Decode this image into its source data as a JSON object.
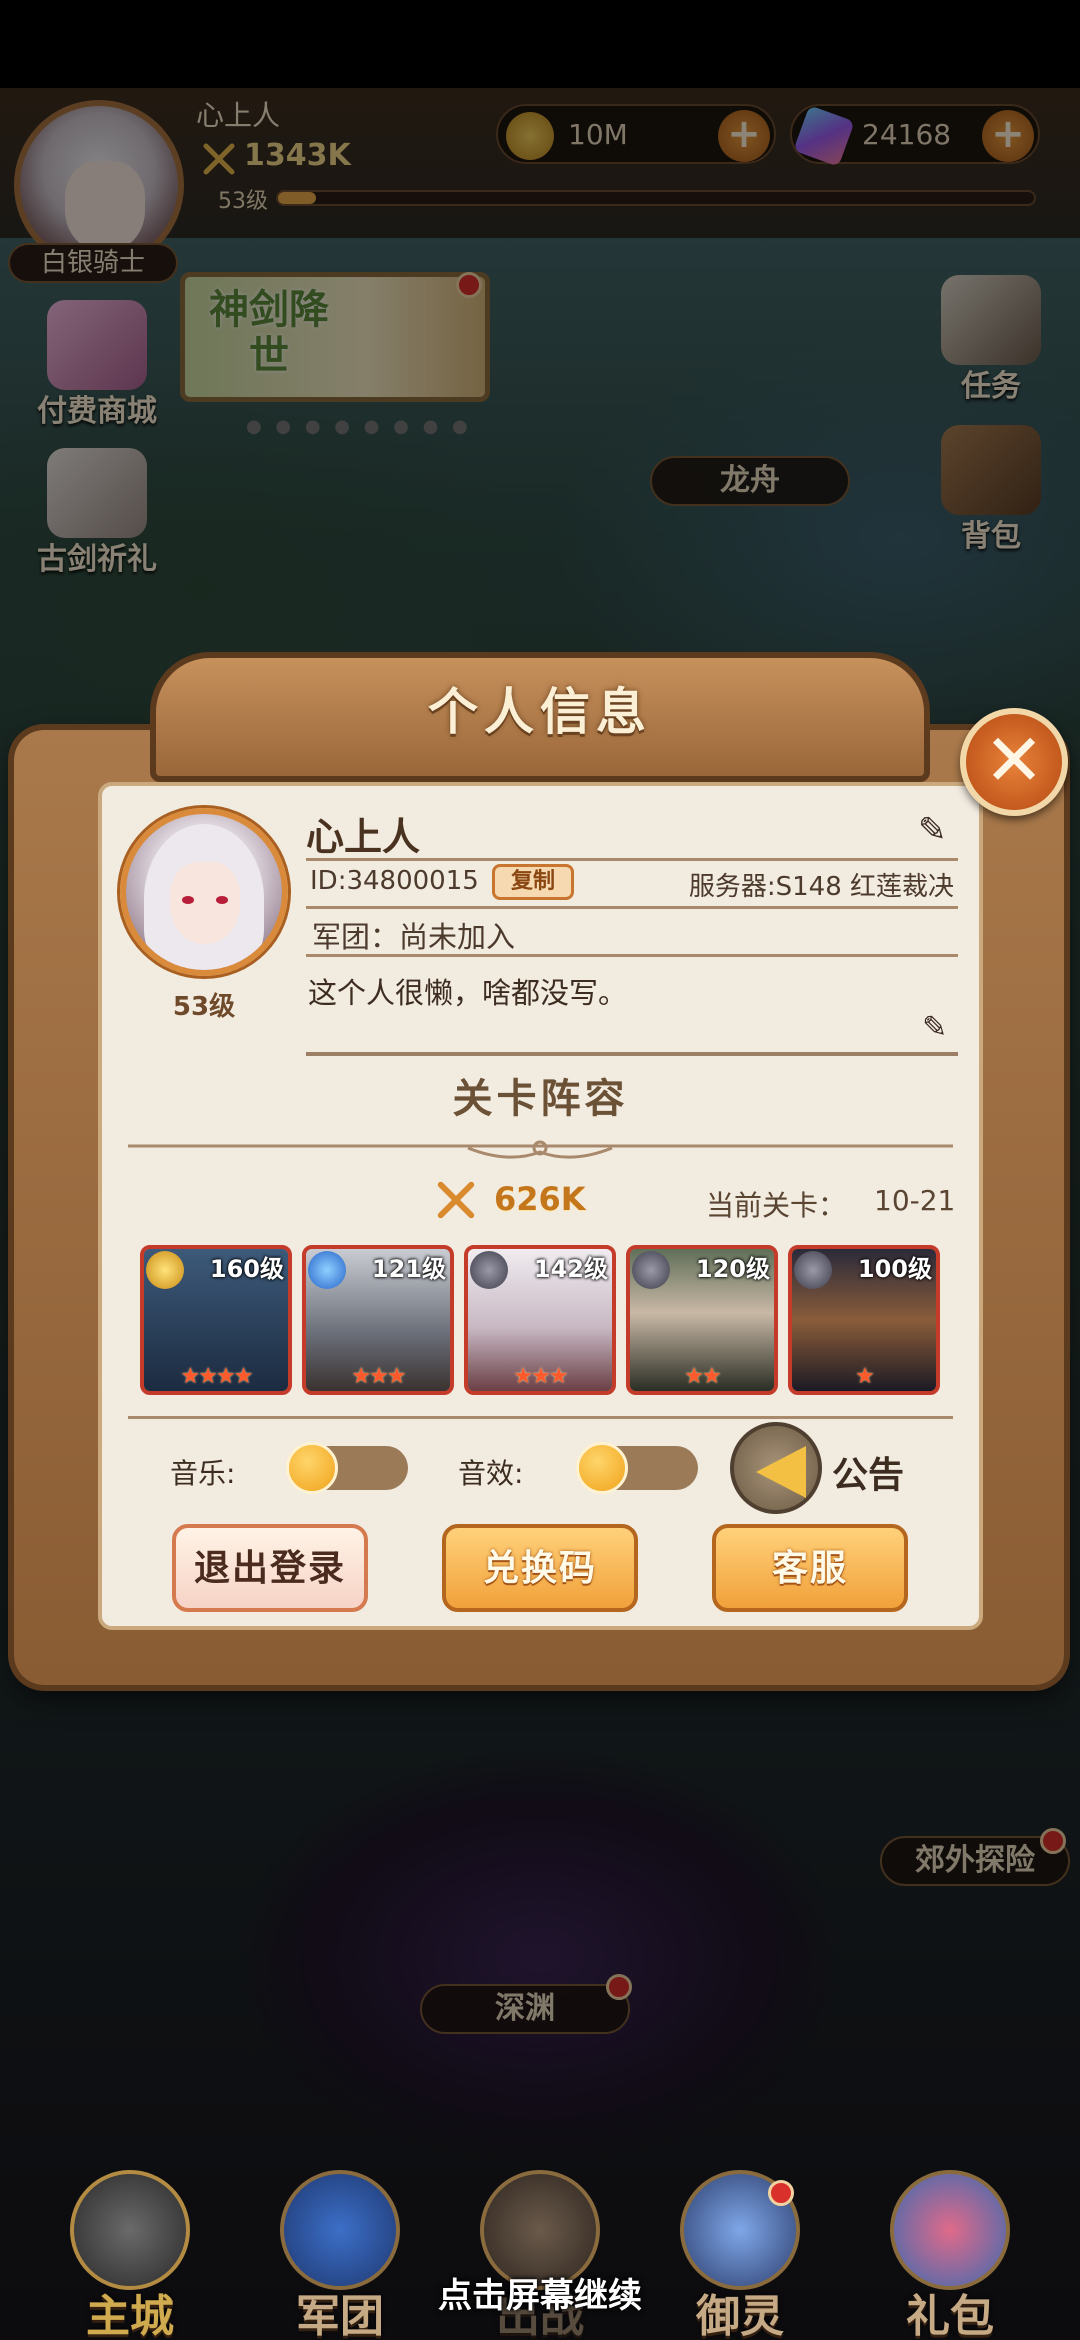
{
  "player": {
    "name": "心上人",
    "power": "1343K",
    "level": "53级",
    "rank_title": "白银骑士",
    "xp_fraction": 0.05
  },
  "currency": {
    "gold": "10M",
    "gems": "24168",
    "plus_symbol": "+"
  },
  "side_menu": {
    "left": [
      "付费商城",
      "古剑祈礼"
    ],
    "right": [
      "任务",
      "背包"
    ]
  },
  "banner": {
    "text": "神剑降世"
  },
  "map_labels": {
    "dragon_boat": "龙舟",
    "outskirts": "郊外探险",
    "abyss": "深渊"
  },
  "modal": {
    "title": "个人信息",
    "close_symbol": "✕",
    "profile": {
      "name": "心上人",
      "level": "53级",
      "id_text": "ID:34800015",
      "copy_label": "复制",
      "server_text": "服务器:S148 红莲裁决",
      "guild_text": "军团：尚未加入",
      "signature": "这个人很懒，啥都没写。",
      "edit_symbol": "✎"
    },
    "lineup": {
      "title": "关卡阵容",
      "power": "626K",
      "stage_label": "当前关卡：",
      "stage_value": "10-21",
      "heroes": [
        {
          "level": "160级",
          "element": "sun-icon",
          "stars": "★★★★"
        },
        {
          "level": "121级",
          "element": "water-icon",
          "stars": "★★★"
        },
        {
          "level": "142级",
          "element": "dark-icon",
          "stars": "★★★"
        },
        {
          "level": "120级",
          "element": "dark-icon",
          "stars": "★★"
        },
        {
          "level": "100级",
          "element": "dark-icon",
          "stars": "★"
        }
      ]
    },
    "settings": {
      "music_label": "音乐:",
      "sfx_label": "音效:",
      "notice_label": "公告",
      "music_on": false,
      "sfx_on": false
    },
    "buttons": {
      "logout": "退出登录",
      "redeem": "兑换码",
      "service": "客服"
    }
  },
  "bottom_nav": [
    "主城",
    "军团",
    "出战",
    "御灵",
    "礼包"
  ],
  "continue_hint": "点击屏幕继续",
  "colors": {
    "accent": "#f1a13a",
    "frame": "#8a5c33",
    "paper": "#f2ebe0",
    "star": "#ff5a2c",
    "badge_red": "#d9302b"
  }
}
